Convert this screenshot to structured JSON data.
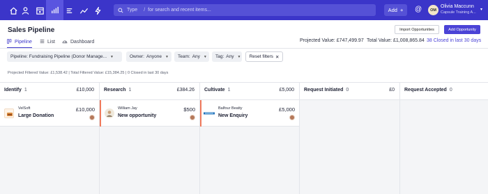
{
  "search": {
    "placeholder": "Type",
    "slash": "/",
    "hint": "for search and recent items..."
  },
  "topbar": {
    "add_label": "Add",
    "user_initials": "OM",
    "user_name": "Olivia Maccunn",
    "user_org": "Capsule Training A..."
  },
  "page": {
    "title": "Sales Pipeline",
    "import_label": "Import Opportunities",
    "add_label": "Add Opportunity",
    "tabs": [
      {
        "label": "Pipeline"
      },
      {
        "label": "List"
      },
      {
        "label": "Dashboard"
      }
    ],
    "projected_value": "Projected Value: £747,499.97",
    "total_value": "Total Value: £1,008,865.84",
    "closed_link": "38 Closed in last 30 days"
  },
  "filters": {
    "pipeline": "Pipeline: Fundraising Pipeline (Donor Manage...",
    "owner_label": "Owner:",
    "owner_value": "Anyone",
    "team_label": "Team:",
    "team_value": "Any",
    "tag_label": "Tag:",
    "tag_value": "Any",
    "reset_label": "Reset filters",
    "summary": "Projected Filtered Value: £1,538.42 | Total Filtered Value: £15,384.25 | 0 Closed in last 30 days"
  },
  "columns": [
    {
      "name": "Identify",
      "count": "1",
      "total": "£10,000",
      "card": {
        "org": "VelSoft",
        "title": "Large Donation",
        "amount": "£10,000"
      }
    },
    {
      "name": "Research",
      "count": "1",
      "total": "£384.26",
      "card": {
        "org": "William Jay",
        "title": "New opportunity",
        "amount": "$500"
      }
    },
    {
      "name": "Cultivate",
      "count": "1",
      "total": "£5,000",
      "card": {
        "org": "Balfour Beatty",
        "title": "New Enquiry",
        "amount": "£5,000"
      }
    },
    {
      "name": "Request Initiated",
      "count": "0",
      "total": "£0"
    },
    {
      "name": "Request Accepted",
      "count": "0",
      "total": ""
    }
  ],
  "colors": {
    "brand": "#3b35c9",
    "accent_bar": "#f07a5c",
    "primary_button": "#4b43d6"
  }
}
